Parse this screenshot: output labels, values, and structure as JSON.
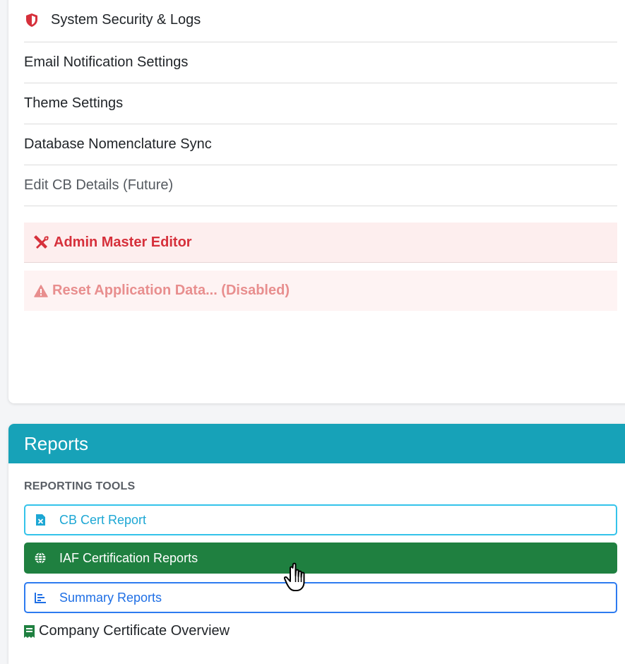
{
  "admin": {
    "items": [
      {
        "label": "System Security & Logs",
        "icon": "shield-icon"
      },
      {
        "label": "Email Notification Settings"
      },
      {
        "label": "Theme Settings"
      },
      {
        "label": "Database Nomenclature Sync"
      },
      {
        "label": "Edit CB Details (Future)"
      }
    ],
    "master_editor_label": "Admin Master Editor",
    "reset_label": "Reset Application Data... (Disabled)"
  },
  "reports": {
    "title": "Reports",
    "section_heading": "REPORTING TOOLS",
    "buttons": [
      {
        "label": "CB Cert Report",
        "icon": "file-excel-icon",
        "color": "#1da7d4"
      },
      {
        "label": "IAF Certification Reports",
        "icon": "globe-icon",
        "color": "#1f8040"
      },
      {
        "label": "Summary Reports",
        "icon": "chart-bar-icon",
        "color": "#1f6fe5"
      }
    ],
    "overview_label": "Company Certificate Overview",
    "overview_icon": "receipt-icon"
  },
  "colors": {
    "danger": "#d6303b",
    "danger_muted": "#e88e8e",
    "header": "#17a2b8"
  }
}
